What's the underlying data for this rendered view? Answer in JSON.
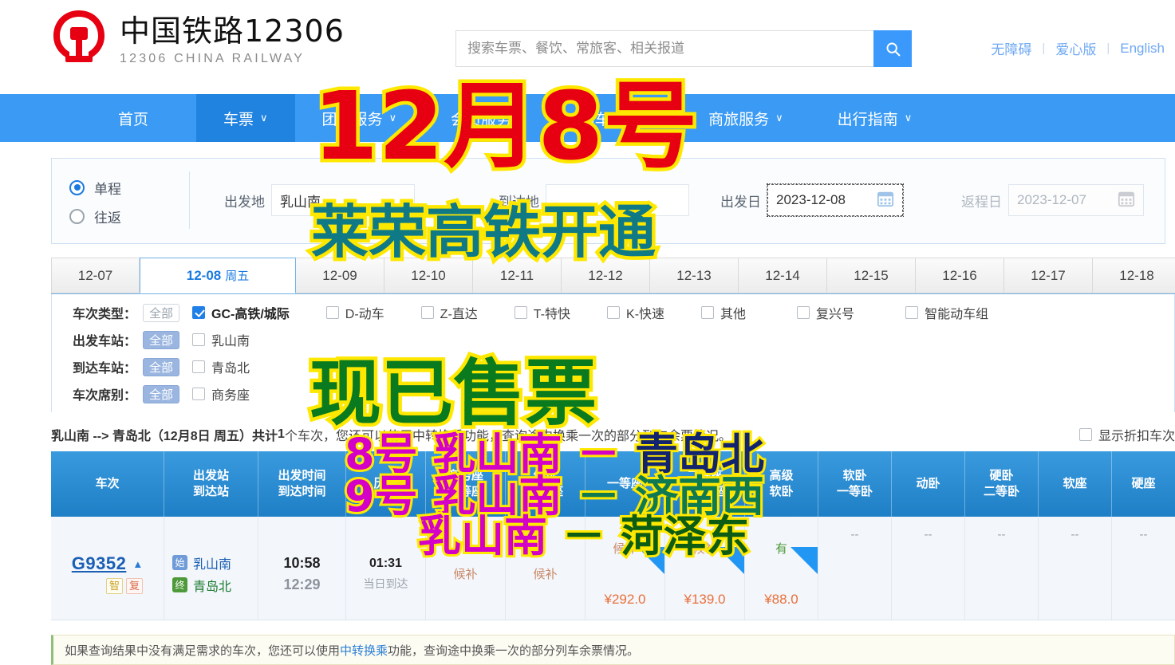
{
  "header": {
    "logo_cn": "中国铁路12306",
    "logo_en": "12306 CHINA RAILWAY",
    "search_placeholder": "搜索车票、餐饮、常旅客、相关报道",
    "search_value": "",
    "search_icon": "search-icon",
    "top_links": [
      "无障碍",
      "爱心版",
      "English"
    ],
    "separator": "|"
  },
  "nav": {
    "items": [
      {
        "label": "首页",
        "caret": "",
        "active": false
      },
      {
        "label": "车票",
        "caret": "∨",
        "active": true
      },
      {
        "label": "团购服务",
        "caret": "∨",
        "active": false
      },
      {
        "label": "会员服务",
        "caret": "∨",
        "active": false
      },
      {
        "label": "站车服务",
        "caret": "∨",
        "active": false
      },
      {
        "label": "商旅服务",
        "caret": "∨",
        "active": false
      },
      {
        "label": "出行指南",
        "caret": "∨",
        "active": false
      }
    ]
  },
  "search_panel": {
    "trip_types": [
      {
        "label": "单程",
        "selected": true
      },
      {
        "label": "往返",
        "selected": false
      }
    ],
    "from_label": "出发地",
    "from_value": "乳山南",
    "to_label": "到达地",
    "to_value": "",
    "depart_label": "出发日",
    "depart_value": "2023-12-08",
    "return_label": "返程日",
    "return_value": "2023-12-07",
    "calendar_icon": "calendar-icon"
  },
  "date_tabs": [
    {
      "date": "12-07",
      "weekday": "",
      "active": false
    },
    {
      "date": "12-08",
      "weekday": "周五",
      "active": true
    },
    {
      "date": "12-09",
      "weekday": "",
      "active": false
    },
    {
      "date": "12-10",
      "weekday": "",
      "active": false
    },
    {
      "date": "12-11",
      "weekday": "",
      "active": false
    },
    {
      "date": "12-12",
      "weekday": "",
      "active": false
    },
    {
      "date": "12-13",
      "weekday": "",
      "active": false
    },
    {
      "date": "12-14",
      "weekday": "",
      "active": false
    },
    {
      "date": "12-15",
      "weekday": "",
      "active": false
    },
    {
      "date": "12-16",
      "weekday": "",
      "active": false
    },
    {
      "date": "12-17",
      "weekday": "",
      "active": false
    },
    {
      "date": "12-18",
      "weekday": "",
      "active": false
    }
  ],
  "filters": [
    {
      "label": "车次类型：",
      "all": "全部",
      "all_on": false,
      "options": [
        {
          "label": "GC-高铁/城际",
          "checked": true
        },
        {
          "label": "D-动车",
          "checked": false
        },
        {
          "label": "Z-直达",
          "checked": false
        },
        {
          "label": "T-特快",
          "checked": false
        },
        {
          "label": "K-快速",
          "checked": false
        },
        {
          "label": "其他",
          "checked": false
        },
        {
          "label": "复兴号",
          "checked": false
        },
        {
          "label": "智能动车组",
          "checked": false
        }
      ]
    },
    {
      "label": "出发车站：",
      "all": "全部",
      "all_on": true,
      "options": [
        {
          "label": "乳山南",
          "checked": false
        }
      ]
    },
    {
      "label": "到达车站：",
      "all": "全部",
      "all_on": true,
      "options": [
        {
          "label": "青岛北",
          "checked": false
        }
      ]
    },
    {
      "label": "车次席别：",
      "all": "全部",
      "all_on": true,
      "options": [
        {
          "label": "商务座",
          "checked": false
        }
      ]
    }
  ],
  "summary": {
    "route": "乳山南 --> 青岛北（12月8日 周五）共计",
    "count": "1",
    "route_tail": "个车次，您还可以使用中转换乘功能，查询途中换乘一次的部分列车余票情况。",
    "discount_label": "显示折扣车次"
  },
  "table": {
    "headers": [
      {
        "line1": "车次",
        "line2": ""
      },
      {
        "line1": "出发站",
        "line2": "到达站"
      },
      {
        "line1": "出发时间",
        "line2": "到达时间"
      },
      {
        "line1": "历时",
        "line2": ""
      },
      {
        "line1": "商务座",
        "line2": "特等座"
      },
      {
        "line1": "优选",
        "line2": "一等座"
      },
      {
        "line1": "一等座",
        "line2": ""
      },
      {
        "line1": "二等座",
        "line2": "二等包座"
      },
      {
        "line1": "高级",
        "line2": "软卧"
      },
      {
        "line1": "软卧",
        "line2": "一等卧"
      },
      {
        "line1": "动卧",
        "line2": ""
      },
      {
        "line1": "硬卧",
        "line2": "二等卧"
      },
      {
        "line1": "软座",
        "line2": ""
      },
      {
        "line1": "硬座",
        "line2": ""
      }
    ],
    "rows": [
      {
        "train_no": "G9352",
        "badges": [
          "智",
          "复"
        ],
        "from_tag": "始",
        "from_station": "乳山南",
        "to_tag": "终",
        "to_station": "青岛北",
        "depart_time": "10:58",
        "arrive_time": "12:29",
        "duration": "01:31",
        "arrive_note": "当日到达",
        "seats": [
          {
            "status": "候补",
            "kind": "wait",
            "price": ""
          },
          {
            "status": "候补",
            "kind": "wait",
            "price": ""
          },
          {
            "status": "候补",
            "kind": "wait",
            "price": "¥292.0"
          },
          {
            "status": "候补",
            "kind": "wait",
            "price": "¥139.0"
          },
          {
            "status": "有",
            "kind": "yes",
            "price": "¥88.0"
          },
          {
            "status": "--",
            "kind": "na",
            "price": ""
          },
          {
            "status": "--",
            "kind": "na",
            "price": ""
          },
          {
            "status": "--",
            "kind": "na",
            "price": ""
          },
          {
            "status": "--",
            "kind": "na",
            "price": ""
          },
          {
            "status": "--",
            "kind": "na",
            "price": ""
          },
          {
            "status": "--",
            "kind": "na",
            "price": ""
          }
        ]
      }
    ]
  },
  "tip": {
    "before": "如果查询结果中没有满足需求的车次，您还可以使用",
    "link": "中转换乘",
    "after": " 功能，查询途中换乘一次的部分列车余票情况。"
  },
  "overlay": {
    "line1": "12月8号",
    "line2": "莱荣高铁开通",
    "line3": "现已售票",
    "r1_day": "8号",
    "r1_from": "乳山南",
    "r1_dash": "－",
    "r1_to": "青岛北",
    "r2_day": "9号",
    "r2_from": "乳山南",
    "r2_dash": "－",
    "r2_to": "济南西",
    "r3_from": "乳山南",
    "r3_dash": "－",
    "r3_to": "菏泽东"
  },
  "colors": {
    "brand_blue": "#3b9bf4",
    "nav_active": "#2183e0",
    "logo_red": "#e60012",
    "price_orange": "#e8703a",
    "available_green": "#4e9a3b",
    "overlay_yellow": "#ffe800",
    "overlay_red": "#e60012"
  }
}
